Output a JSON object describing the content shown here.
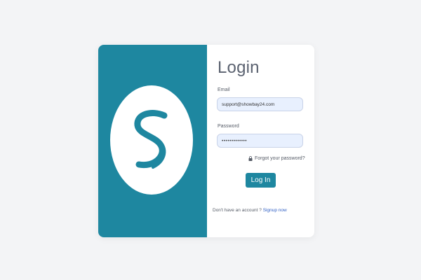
{
  "colors": {
    "page_bg": "#f3f4f6",
    "brand": "#1e87a0",
    "field_bg": "#e8f0fe",
    "link": "#2f5fc4"
  },
  "brand_panel": {
    "logo_icon": "stylized-s-logo-icon"
  },
  "form": {
    "title": "Login",
    "email": {
      "label": "Email",
      "value": "support@showbay24.com"
    },
    "password": {
      "label": "Password",
      "value": "•••••••••••••"
    },
    "forgot": {
      "icon": "lock-icon",
      "label": "Forgot your password?"
    },
    "submit_label": "Log In",
    "signup": {
      "prompt": "Don't have an account ?",
      "link_label": "Signup now"
    }
  }
}
